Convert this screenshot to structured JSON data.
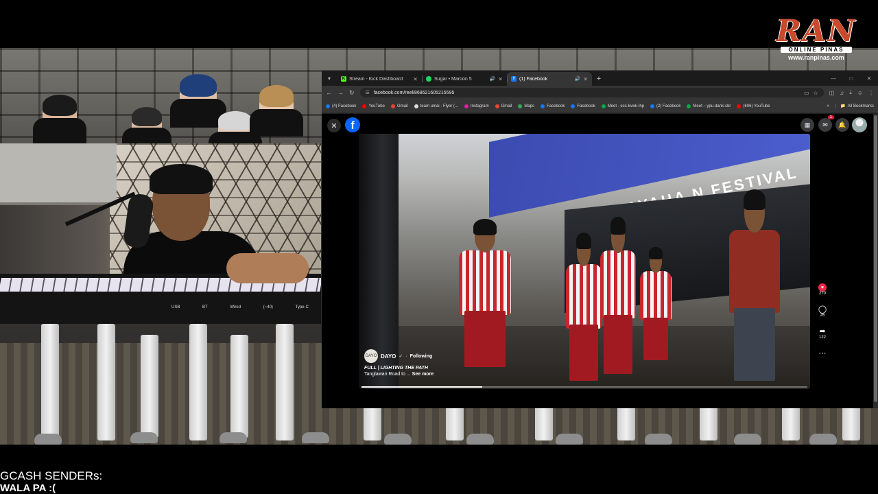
{
  "logo": {
    "brand": "RAN",
    "tagline": "ONLINE PINAS",
    "site": "www.ranpinas.com"
  },
  "webcam": {
    "keyboard_labels": [
      "USB",
      "BT",
      "Wired",
      "(~40)",
      "Type-C"
    ]
  },
  "browser": {
    "tabs": [
      {
        "title": "Stream - Kick Dashboard",
        "favicon": "kick-icon",
        "color": "#53fc18",
        "glyph": "K",
        "active": false,
        "audio": false
      },
      {
        "title": "Sugar • Maroon 5",
        "favicon": "spotify-icon",
        "color": "#1ed760",
        "glyph": "",
        "active": false,
        "audio": true
      },
      {
        "title": "(1) Facebook",
        "favicon": "facebook-icon",
        "color": "#1877f2",
        "glyph": "f",
        "active": true,
        "audio": true
      }
    ],
    "url": "facebook.com/reel/868621605215595",
    "bookmarks": [
      {
        "label": "(4) Facebook",
        "color": "#1877f2"
      },
      {
        "label": "YouTube",
        "color": "#ff0000"
      },
      {
        "label": "Gmail",
        "color": "#ea4335"
      },
      {
        "label": "team umai - Flyer (...",
        "color": "#dddddd"
      },
      {
        "label": "Instagram",
        "color": "#d6249f"
      },
      {
        "label": "Gmail",
        "color": "#ea4335"
      },
      {
        "label": "Maps",
        "color": "#34a853"
      },
      {
        "label": "Facebook",
        "color": "#1877f2"
      },
      {
        "label": "Facebook",
        "color": "#1877f2"
      },
      {
        "label": "Meet - ecs-kvwk-ihp",
        "color": "#00ac47"
      },
      {
        "label": "(2) Facebook",
        "color": "#1877f2"
      },
      {
        "label": "Meet – ypu-dank-sbr",
        "color": "#00ac47"
      },
      {
        "label": "(606) YouTube",
        "color": "#ff0000"
      }
    ],
    "all_bookmarks_label": "All Bookmarks"
  },
  "facebook": {
    "notification_badge": "1",
    "video": {
      "banner_text": "NGGAYAHA N FESTIVAL",
      "progress": 0.27
    },
    "caption": {
      "avatar_text": "DAYO",
      "page_name": "DAYO",
      "follow_label": "Following",
      "title": "FULL | LIGHTING THE PATH",
      "description": "Tanglawan Road to ...",
      "see_more": "See more"
    },
    "actions": {
      "likes": "270",
      "comments": "26",
      "shares": "122"
    }
  },
  "gcash": {
    "label": "GCASH SENDERs:",
    "value": "WALA PA :("
  }
}
